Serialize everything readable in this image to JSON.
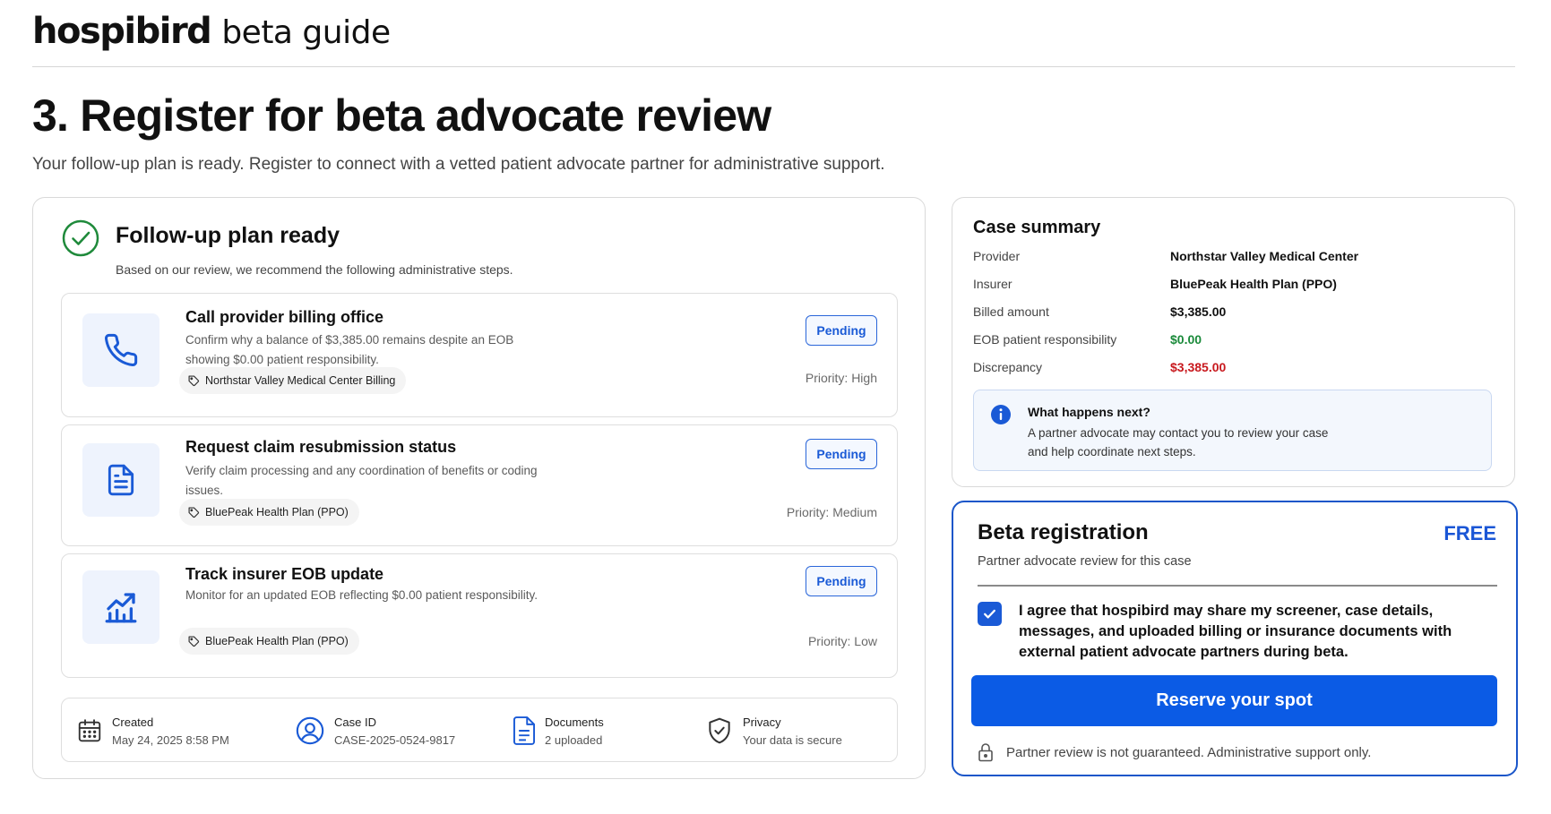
{
  "header": {
    "brand": "hospibird",
    "brand_suffix": "beta guide"
  },
  "page": {
    "title": "3. Register for beta advocate review",
    "subtitle": "Your follow-up plan is ready. Register to connect with a vetted patient advocate partner for administrative support."
  },
  "plan": {
    "title": "Follow-up plan ready",
    "subtitle": "Based on our review, we recommend the following administrative steps.",
    "steps": [
      {
        "icon": "phone-icon",
        "title": "Call provider billing office",
        "description": "Confirm why a balance of $3,385.00 remains despite an EOB showing $0.00 patient responsibility.",
        "tag": "Northstar Valley Medical Center Billing",
        "status": "Pending",
        "priority": "Priority: High"
      },
      {
        "icon": "document-icon",
        "title": "Request claim resubmission status",
        "description": "Verify claim processing and any coordination of benefits or coding issues.",
        "tag": "BluePeak Health Plan (PPO)",
        "status": "Pending",
        "priority": "Priority: Medium"
      },
      {
        "icon": "chart-trend-icon",
        "title": "Track insurer EOB update",
        "description": "Monitor for an updated EOB reflecting $0.00 patient responsibility.",
        "tag": "BluePeak Health Plan (PPO)",
        "status": "Pending",
        "priority": "Priority: Low"
      }
    ]
  },
  "meta": {
    "created_label": "Created",
    "created_value": "May 24, 2025 8:58 PM",
    "case_id_label": "Case ID",
    "case_id_value": "CASE-2025-0524-9817",
    "documents_label": "Documents",
    "documents_value": "2 uploaded",
    "privacy_label": "Privacy",
    "privacy_value": "Your data is secure"
  },
  "summary": {
    "title": "Case summary",
    "rows": [
      {
        "key": "Provider",
        "value": "Northstar Valley Medical Center"
      },
      {
        "key": "Insurer",
        "value": "BluePeak Health Plan (PPO)"
      },
      {
        "key": "Billed amount",
        "value": "$3,385.00"
      },
      {
        "key": "EOB patient responsibility",
        "value": "$0.00"
      },
      {
        "key": "Discrepancy",
        "value": "$3,385.00"
      }
    ],
    "info_title": "What happens next?",
    "info_text": "A partner advocate may contact you to review your case and help coordinate next steps."
  },
  "registration": {
    "title": "Beta registration",
    "price": "FREE",
    "subtitle": "Partner advocate review for this case",
    "consent": "I agree that hospibird may share my screener, case details, messages, and uploaded billing or insurance documents with external patient advocate partners during beta.",
    "consent_checked": true,
    "button_label": "Reserve your spot",
    "footer_note": "Partner review is not guaranteed. Administrative support only."
  },
  "colors": {
    "accent_blue": "#1a5ad6",
    "success_green": "#1a8a3a",
    "danger_red": "#c8191e"
  }
}
